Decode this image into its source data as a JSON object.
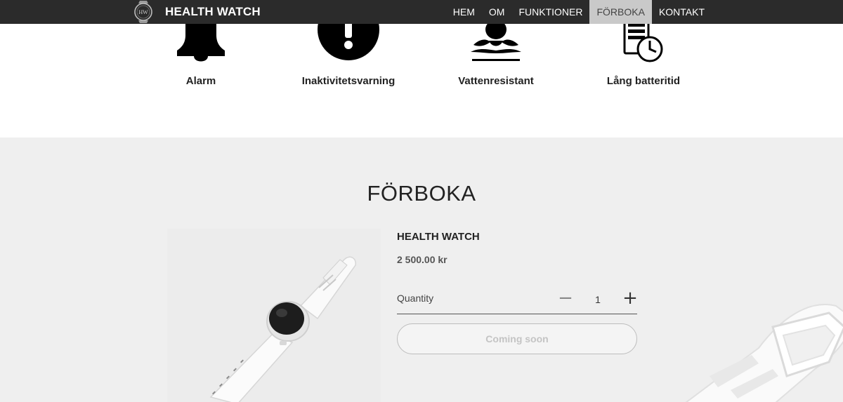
{
  "header": {
    "brand_name": "HEALTH WATCH",
    "logo_text": "HW",
    "nav": [
      {
        "label": "HEM"
      },
      {
        "label": "OM"
      },
      {
        "label": "FUNKTIONER"
      },
      {
        "label": "FÖRBOKA",
        "active": true
      },
      {
        "label": "KONTAKT"
      }
    ]
  },
  "features": [
    {
      "label": "Alarm",
      "icon": "bell-icon"
    },
    {
      "label": "Inaktivitetsvarning",
      "icon": "exclamation-icon"
    },
    {
      "label": "Vattenresistant",
      "icon": "water-splash-icon"
    },
    {
      "label": "Lång batteritid",
      "icon": "battery-clock-icon"
    }
  ],
  "preorder": {
    "title": "FÖRBOKA",
    "product_name": "HEALTH WATCH",
    "price": "2 500.00 kr",
    "quantity_label": "Quantity",
    "quantity_value": "1",
    "minus_symbol": "−",
    "plus_symbol": "+",
    "button_label": "Coming soon"
  },
  "colors": {
    "nav_background": "#2b2b2b",
    "nav_active_background": "#c9c9c9",
    "section_background": "#efefef",
    "button_text_disabled": "#c4c4c4"
  }
}
